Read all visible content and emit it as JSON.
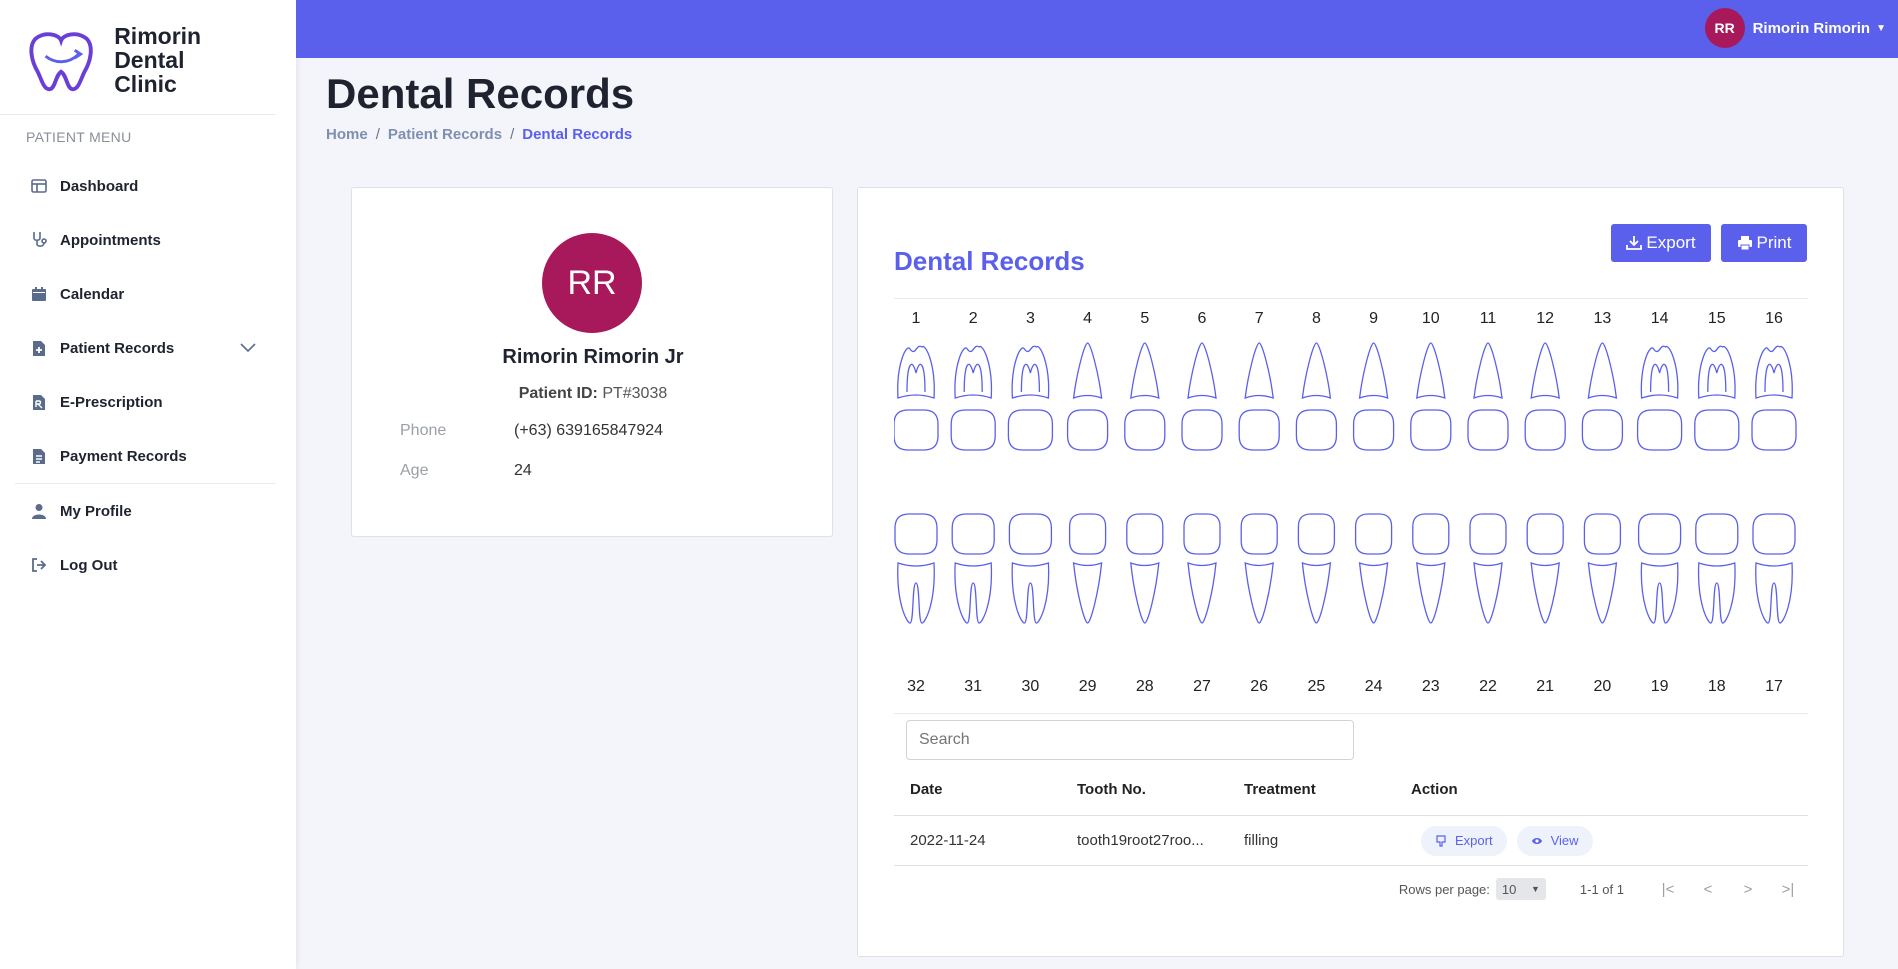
{
  "brand": {
    "line1": "Rimorin",
    "line2": "Dental Clinic"
  },
  "sidebar": {
    "menu_title": "PATIENT MENU",
    "items": [
      {
        "label": "Dashboard",
        "icon": "layout-icon"
      },
      {
        "label": "Appointments",
        "icon": "stethoscope-icon"
      },
      {
        "label": "Calendar",
        "icon": "calendar-icon"
      },
      {
        "label": "Patient Records",
        "icon": "file-medical-icon",
        "expandable": true
      },
      {
        "label": "E-Prescription",
        "icon": "prescription-icon"
      },
      {
        "label": "Payment Records",
        "icon": "receipt-icon"
      },
      {
        "label": "My Profile",
        "icon": "user-icon"
      },
      {
        "label": "Log Out",
        "icon": "logout-icon"
      }
    ]
  },
  "topbar": {
    "user_initials": "RR",
    "user_name": "Rimorin Rimorin"
  },
  "page": {
    "title": "Dental Records",
    "breadcrumb": [
      "Home",
      "Patient Records",
      "Dental Records"
    ]
  },
  "profile": {
    "initials": "RR",
    "name": "Rimorin Rimorin Jr",
    "patient_id_label": "Patient ID:",
    "patient_id": "PT#3038",
    "phone_label": "Phone",
    "phone": "(+63) 639165847924",
    "age_label": "Age",
    "age": "24"
  },
  "records": {
    "title": "Dental Records",
    "export_label": "Export",
    "print_label": "Print",
    "upper_teeth": [
      "1",
      "2",
      "3",
      "4",
      "5",
      "6",
      "7",
      "8",
      "9",
      "10",
      "11",
      "12",
      "13",
      "14",
      "15",
      "16"
    ],
    "lower_teeth": [
      "32",
      "31",
      "30",
      "29",
      "28",
      "27",
      "26",
      "25",
      "24",
      "23",
      "22",
      "21",
      "20",
      "19",
      "18",
      "17"
    ],
    "search_placeholder": "Search",
    "columns": [
      "Date",
      "Tooth No.",
      "Treatment",
      "Action"
    ],
    "rows": [
      {
        "date": "2022-11-24",
        "tooth": "tooth19root27roo...",
        "treatment": "filling",
        "export_label": "Export",
        "view_label": "View"
      }
    ],
    "pager": {
      "rows_label": "Rows per page:",
      "rows_value": "10",
      "range": "1-1 of 1"
    }
  },
  "colors": {
    "accent": "#5b60ec",
    "avatar": "#a8195c",
    "tooth_stroke": "#5b60ec"
  }
}
